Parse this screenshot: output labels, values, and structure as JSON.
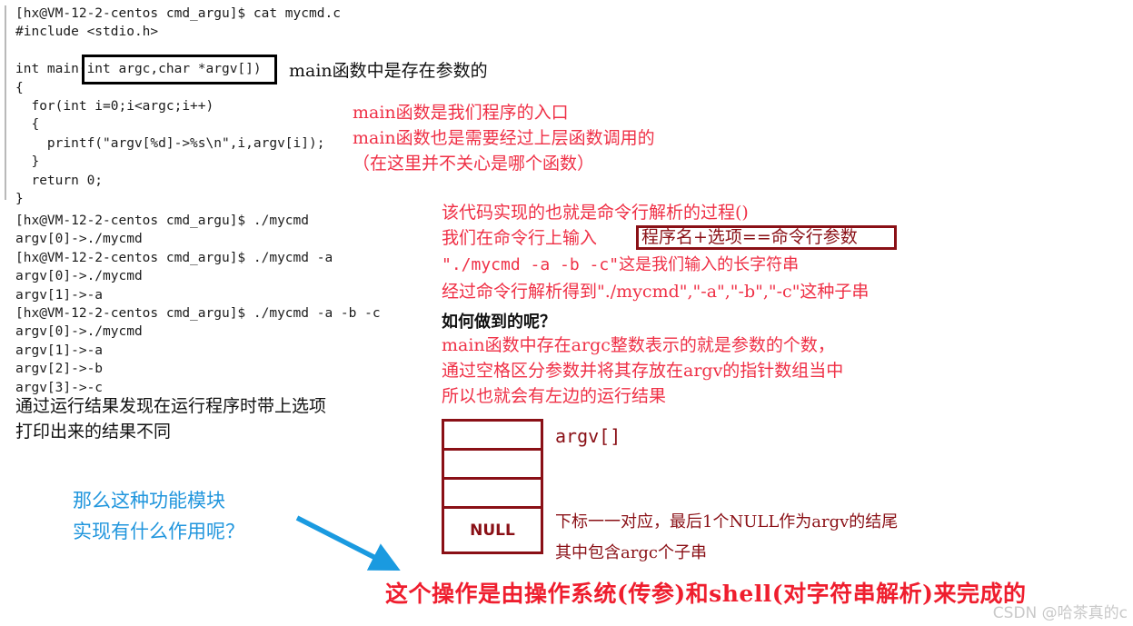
{
  "terminal": {
    "cat_session": "[hx@VM-12-2-centos cmd_argu]$ cat mycmd.c\n#include <stdio.h>\n\nint main(int argc,char *argv[])\n{\n  for(int i=0;i<argc;i++)\n  {\n    printf(\"argv[%d]->%s\\n\",i,argv[i]);\n  }\n  return 0;\n}",
    "run_session": "[hx@VM-12-2-centos cmd_argu]$ ./mycmd\nargv[0]->./mycmd\n[hx@VM-12-2-centos cmd_argu]$ ./mycmd -a\nargv[0]->./mycmd\nargv[1]->-a\n[hx@VM-12-2-centos cmd_argu]$ ./mycmd -a -b -c\nargv[0]->./mycmd\nargv[1]->-a\nargv[2]->-b\nargv[3]->-c",
    "prompt": "[hx@VM-12-2-centos cmd_argu]$",
    "commands": [
      "cat mycmd.c",
      "./mycmd",
      "./mycmd -a",
      "./mycmd -a -b -c"
    ],
    "highlight_box_text": "(int argc,char *argv[])"
  },
  "annotations": {
    "main_params_note": "main函数中是存在参数的",
    "entry_note_line1": "main函数是我们程序的入口",
    "entry_note_line2": "main函数也是需要经过上层函数调用的",
    "entry_note_line3": "（在这里并不关心是哪个函数）",
    "parse_line1": "该代码实现的也就是命令行解析的过程()",
    "parse_line2_prefix": "我们在命令行上输入",
    "parse_line2_boxed": "程序名+选项==命令行参数",
    "parse_line3": "\"./mycmd -a -b -c\"这是我们输入的长字符串",
    "parse_line4": "经过命令行解析得到\"./mycmd\",\"-a\",\"-b\",\"-c\"这种子串",
    "how_question": "如何做到的呢？",
    "how_line1": "main函数中存在argc整数表示的就是参数的个数，",
    "how_line2": "通过空格区分参数并将其存放在argv的指针数组当中",
    "how_line3": "所以也就会有左边的运行结果",
    "result_note_line1": "通过运行结果发现在运行程序时带上选项",
    "result_note_line2": "打印出来的结果不同",
    "blue_question_line1": "那么这种功能模块",
    "blue_question_line2": "实现有什么作用呢？",
    "argv_note_line1": "下标一一对应，最后1个NULL作为argv的结尾",
    "argv_note_line2": "其中包含argc个子串",
    "conclusion": "这个操作是由操作系统(传参)和shell(对字符串解析)来完成的"
  },
  "argv_diagram": {
    "label": "argv[]",
    "cells": [
      "",
      "",
      "",
      "NULL"
    ]
  },
  "watermark": "CSDN @哈茶真的c",
  "colors": {
    "terminal_text": "#1b1b1b",
    "annotation_red": "#ef3046",
    "annotation_darkred": "#8a1016",
    "annotation_blue": "#2196dd",
    "conclusion_red": "#ef1e2e",
    "box_black": "#000000",
    "watermark_gray": "#c9c9c9",
    "background": "#ffffff"
  }
}
